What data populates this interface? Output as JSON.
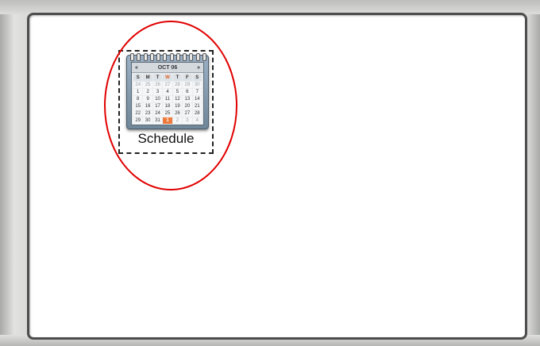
{
  "desktop": {
    "icon": {
      "label": "Schedule",
      "icon_name": "calendar-icon",
      "calendar": {
        "month_label": "OCT 06",
        "prev_glyph": "«",
        "next_glyph": "»",
        "weekdays": [
          "S",
          "M",
          "T",
          "W",
          "T",
          "F",
          "S"
        ],
        "highlighted_weekday_index": 3,
        "days": [
          "24",
          "25",
          "26",
          "27",
          "28",
          "29",
          "30",
          "1",
          "2",
          "3",
          "4",
          "5",
          "6",
          "7",
          "8",
          "9",
          "10",
          "11",
          "12",
          "13",
          "14",
          "15",
          "16",
          "17",
          "18",
          "19",
          "20",
          "21",
          "22",
          "23",
          "24",
          "25",
          "26",
          "27",
          "28",
          "29",
          "30",
          "31",
          "1",
          "2",
          "3",
          "4"
        ],
        "today_index": 38,
        "dim_indices": [
          0,
          1,
          2,
          3,
          4,
          5,
          6,
          39,
          40,
          41
        ],
        "today_color": "#f07a3a"
      }
    },
    "annotation_color": "#e10000"
  }
}
